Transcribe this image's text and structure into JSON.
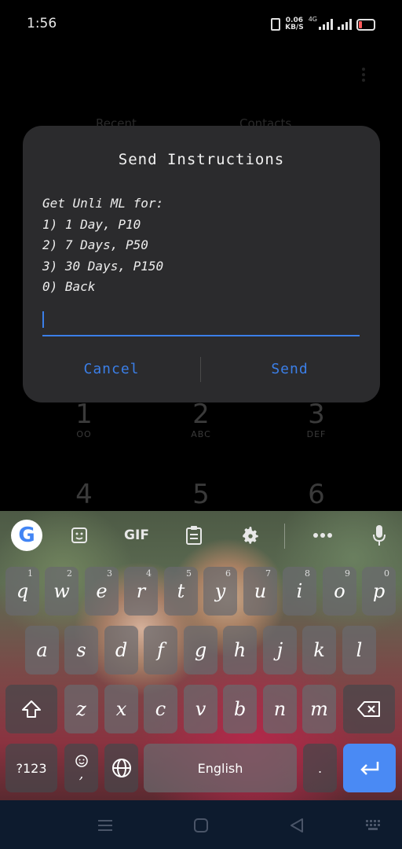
{
  "status_bar": {
    "time": "1:56",
    "speed_value": "0.06",
    "speed_unit": "KB/S",
    "network": "4G"
  },
  "background": {
    "tabs": [
      "Recent",
      "Contacts"
    ],
    "dialpad": [
      {
        "digit": "1",
        "letters": "OO"
      },
      {
        "digit": "2",
        "letters": "ABC"
      },
      {
        "digit": "3",
        "letters": "DEF"
      },
      {
        "digit": "4",
        "letters": ""
      },
      {
        "digit": "5",
        "letters": ""
      },
      {
        "digit": "6",
        "letters": ""
      }
    ]
  },
  "dialog": {
    "title": "Send Instructions",
    "lines": [
      "Get Unli ML for:",
      "1) 1 Day, P10",
      "2) 7 Days, P50",
      "3) 30 Days, P150",
      "0) Back"
    ],
    "input_value": "",
    "cancel_label": "Cancel",
    "send_label": "Send"
  },
  "keyboard": {
    "toolbar": {
      "gif_label": "GIF"
    },
    "row1": [
      {
        "key": "q",
        "hint": "1"
      },
      {
        "key": "w",
        "hint": "2"
      },
      {
        "key": "e",
        "hint": "3"
      },
      {
        "key": "r",
        "hint": "4"
      },
      {
        "key": "t",
        "hint": "5"
      },
      {
        "key": "y",
        "hint": "6"
      },
      {
        "key": "u",
        "hint": "7"
      },
      {
        "key": "i",
        "hint": "8"
      },
      {
        "key": "o",
        "hint": "9"
      },
      {
        "key": "p",
        "hint": "0"
      }
    ],
    "row2": [
      "a",
      "s",
      "d",
      "f",
      "g",
      "h",
      "j",
      "k",
      "l"
    ],
    "row3": [
      "z",
      "x",
      "c",
      "v",
      "b",
      "n",
      "m"
    ],
    "symbols_label": "?123",
    "comma_label": ",",
    "space_label": "English",
    "period_label": "."
  },
  "colors": {
    "accent": "#3b7fe8",
    "dialog_bg": "#2b2b2d",
    "enter_key": "#4a8af4",
    "navbar": "#0d1b2e"
  }
}
